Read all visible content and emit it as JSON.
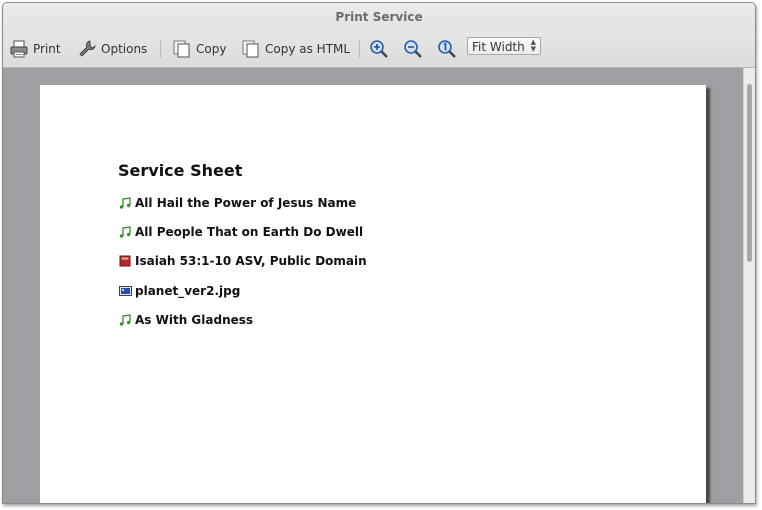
{
  "window": {
    "title": "Print Service"
  },
  "toolbar": {
    "print_label": "Print",
    "options_label": "Options",
    "copy_label": "Copy",
    "copy_html_label": "Copy as HTML",
    "zoom_select": "Fit Width"
  },
  "sheet": {
    "title": "Service Sheet",
    "items": [
      {
        "label": "All Hail the Power of Jesus Name",
        "icon": "song-icon"
      },
      {
        "label": "All People That on Earth Do Dwell",
        "icon": "song-icon"
      },
      {
        "label": "Isaiah 53:1-10 ASV, Public Domain",
        "icon": "bible-icon"
      },
      {
        "label": "planet_ver2.jpg",
        "icon": "image-icon"
      },
      {
        "label": "As With Gladness",
        "icon": "song-icon"
      }
    ]
  },
  "colors": {
    "song_icon": "#3a8c2f",
    "bible_icon": "#b52a2a",
    "image_icon": "#2b4fa8",
    "viewport_bg": "#9f9fa3"
  }
}
